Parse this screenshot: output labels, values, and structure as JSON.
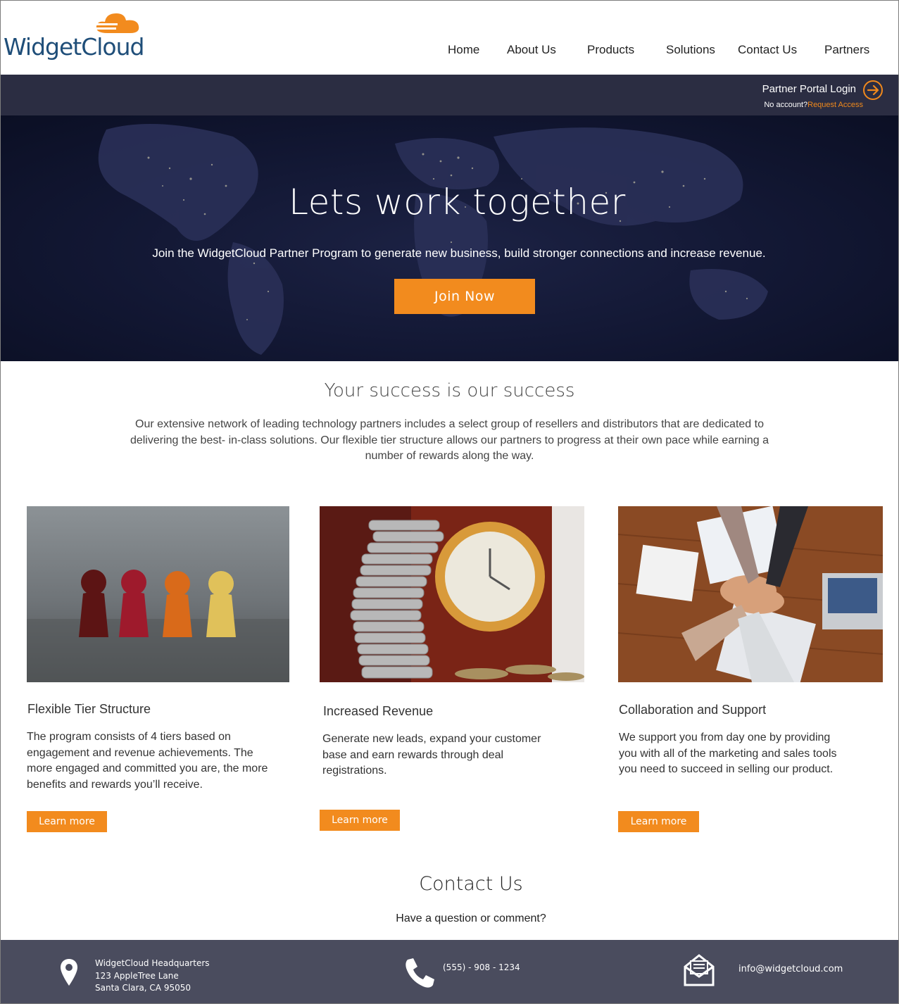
{
  "brand": {
    "name": "WidgetCloud",
    "accent": "#f28b1e",
    "logo_text_color": "#1f4e79",
    "portal_bar_color": "#2b2d42",
    "footer_color": "#4a4c5e"
  },
  "nav": {
    "items": [
      {
        "label": "Home"
      },
      {
        "label": "About Us"
      },
      {
        "label": "Products"
      },
      {
        "label": "Solutions"
      },
      {
        "label": "Contact Us"
      },
      {
        "label": "Partners"
      }
    ]
  },
  "portal": {
    "login_label": "Partner Portal Login",
    "no_account_label": "No account?",
    "request_access_label": "Request Access"
  },
  "hero": {
    "title": "Lets work together",
    "subtitle": "Join the WidgetCloud Partner Program to generate new business, build stronger connections and increase revenue.",
    "cta_label": "Join Now"
  },
  "success": {
    "title": "Your success is our success",
    "text": "Our extensive network of leading technology partners includes a select group of resellers and distributors that are dedicated to delivering the best- in-class solutions. Our flexible tier structure allows our partners to progress at their own pace while earning a number of rewards along the way."
  },
  "cards": [
    {
      "image_icon": "pawn-figures-image",
      "title": "Flexible Tier Structure",
      "text": "The program consists of 4 tiers based on engagement and revenue achievements. The more engaged and committed you are, the more benefits and rewards you’ll receive.",
      "button_label": "Learn more"
    },
    {
      "image_icon": "coins-clock-image",
      "title": "Increased Revenue",
      "text": "Generate new leads, expand your customer base and earn rewards through deal registrations.",
      "button_label": "Learn more"
    },
    {
      "image_icon": "team-hands-image",
      "title": "Collaboration and Support",
      "text": "We support you from day one by providing you with all of the marketing and sales tools you need to succeed in selling our product.",
      "button_label": "Learn more"
    }
  ],
  "contact": {
    "title": "Contact Us",
    "subtitle": "Have a question or comment?"
  },
  "footer": {
    "address_line1": "WidgetCloud Headquarters",
    "address_line2": "123  AppleTree Lane",
    "address_line3": "Santa Clara, CA 95050",
    "phone": "(555) - 908 - 1234",
    "email": "info@widgetcloud.com"
  }
}
